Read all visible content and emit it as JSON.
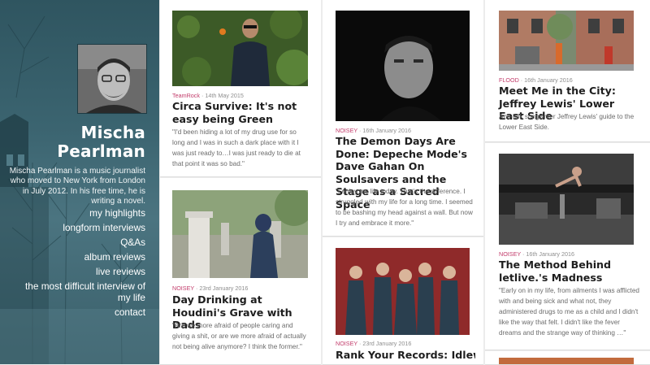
{
  "author": {
    "name_line1": "Mischa",
    "name_line2": "Pearlman",
    "bio": "Mischa Pearlman is a music journalist who moved to New York from London in July 2012. In his free time, he is writing a novel."
  },
  "nav": {
    "items": [
      "my highlights",
      "longform interviews",
      "Q&As",
      "album reviews",
      "live reviews",
      "the most difficult interview of my life",
      "contact"
    ]
  },
  "articles": {
    "a1": {
      "source": "TeamRock",
      "date": "14th May 2015",
      "title": "Circa Survive: It's not easy being Green",
      "excerpt": "\"I'd been hiding a lot of my drug use for so long and I was in such a dark place with it I was just ready to…I was just ready to die at that point it was so bad.\""
    },
    "a2": {
      "source": "NOISEY",
      "date": "23rd January 2016",
      "title": "Day Drinking at Houdini's Grave with Dads",
      "excerpt": "\"Are we more afraid of people caring and giving a shit, or are we more afraid of actually not being alive anymore? I think the former.\""
    },
    "a3": {
      "source": "NOISEY",
      "date": "16th January 2016",
      "title": "The Demon Days Are Done: Depeche Mode's Dave Gahan On Soulsavers and the Stage as a Sacred Space",
      "excerpt": "\"I enjoy my life today. That's the difference. I struggled with my life for a long time. I seemed to be bashing my head against a wall. But now I try and embrace it more.\""
    },
    "a4": {
      "source": "NOISEY",
      "date": "23rd January 2016",
      "title": "Rank Your Records: Idlewild Rank Their Seven Records"
    },
    "a5": {
      "source": "FLOOD",
      "date": "16th January 2016",
      "title": "Meet Me in the City: Jeffrey Lewis' Lower East Side",
      "excerpt": "Anti-folk songwriter Jeffrey Lewis' guide to the Lower East Side."
    },
    "a6": {
      "source": "NOISEY",
      "date": "16th January 2016",
      "title": "The Method Behind letlive.'s Madness",
      "excerpt": "\"Early on in my life, from ailments I was afflicted with and being sick and what not, they administered drugs to me as a child and I didn't like the way that felt. I didn't like the fever dreams and the strange way of thinking …\""
    }
  },
  "colors": {
    "accent": "#c23b6a",
    "sidebar": "#3b6470"
  }
}
